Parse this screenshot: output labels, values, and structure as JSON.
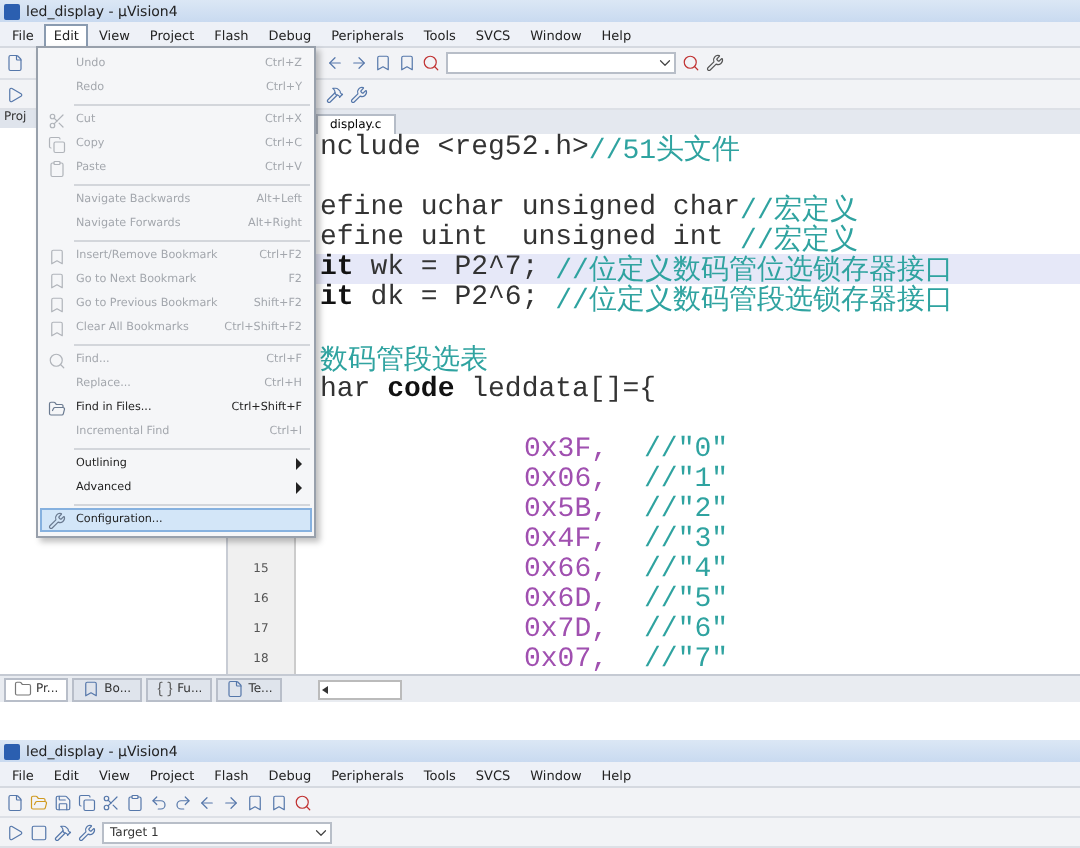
{
  "window": {
    "title": "led_display - µVision4"
  },
  "menu_bar": [
    {
      "label": "File",
      "selected": false
    },
    {
      "label": "Edit",
      "selected": true
    },
    {
      "label": "View",
      "selected": false
    },
    {
      "label": "Project",
      "selected": false
    },
    {
      "label": "Flash",
      "selected": false
    },
    {
      "label": "Debug",
      "selected": false
    },
    {
      "label": "Peripherals",
      "selected": false
    },
    {
      "label": "Tools",
      "selected": false
    },
    {
      "label": "SVCS",
      "selected": false
    },
    {
      "label": "Window",
      "selected": false
    },
    {
      "label": "Help",
      "selected": false
    }
  ],
  "project_panel": {
    "title": "Proj"
  },
  "editor": {
    "tab": "display.c",
    "lines": [
      {
        "kind": "code",
        "highlighted": false,
        "parts": [
          {
            "kind": "plain",
            "text": "nclude <reg52.h>"
          },
          {
            "kind": "comment",
            "text": "//51头文件"
          }
        ]
      },
      {
        "kind": "blank"
      },
      {
        "kind": "code",
        "highlighted": false,
        "parts": [
          {
            "kind": "plain",
            "text": "efine uchar unsigned char"
          },
          {
            "kind": "comment",
            "text": "//宏定义"
          }
        ]
      },
      {
        "kind": "code",
        "highlighted": false,
        "parts": [
          {
            "kind": "plain",
            "text": "efine uint  unsigned int "
          },
          {
            "kind": "comment",
            "text": "//宏定义"
          }
        ]
      },
      {
        "kind": "code",
        "highlighted": true,
        "parts": [
          {
            "kind": "keyword",
            "text": "it"
          },
          {
            "kind": "plain",
            "text": " wk = P2^7; "
          },
          {
            "kind": "comment",
            "text": "//位定义数码管位选锁存器接口"
          }
        ]
      },
      {
        "kind": "code",
        "highlighted": false,
        "parts": [
          {
            "kind": "keyword",
            "text": "it"
          },
          {
            "kind": "plain",
            "text": " dk = P2^6; "
          },
          {
            "kind": "comment",
            "text": "//位定义数码管段选锁存器接口"
          }
        ]
      },
      {
        "kind": "blank"
      },
      {
        "kind": "code",
        "highlighted": false,
        "parts": [
          {
            "kind": "comment",
            "text": "数码管段选表"
          }
        ]
      },
      {
        "kind": "code",
        "highlighted": false,
        "parts": [
          {
            "kind": "plain",
            "text": "har "
          },
          {
            "kind": "keyword",
            "text": "code"
          },
          {
            "kind": "plain",
            "text": " leddata[]={"
          }
        ]
      },
      {
        "kind": "blank"
      },
      {
        "kind": "entry",
        "highlighted": false,
        "parts": [
          {
            "kind": "number",
            "text": "0x3F,"
          },
          {
            "kind": "comment",
            "text": "//\"0\""
          }
        ]
      },
      {
        "kind": "entry",
        "highlighted": false,
        "parts": [
          {
            "kind": "number",
            "text": "0x06,"
          },
          {
            "kind": "comment",
            "text": "//\"1\""
          }
        ]
      },
      {
        "kind": "entry",
        "highlighted": false,
        "parts": [
          {
            "kind": "number",
            "text": "0x5B,"
          },
          {
            "kind": "comment",
            "text": "//\"2\""
          }
        ]
      },
      {
        "kind": "entry",
        "highlighted": false,
        "parts": [
          {
            "kind": "number",
            "text": "0x4F,"
          },
          {
            "kind": "comment",
            "text": "//\"3\""
          }
        ]
      },
      {
        "kind": "entry",
        "highlighted": false,
        "number": "15",
        "parts": [
          {
            "kind": "number",
            "text": "0x66,"
          },
          {
            "kind": "comment",
            "text": "//\"4\""
          }
        ]
      },
      {
        "kind": "entry",
        "highlighted": false,
        "number": "16",
        "parts": [
          {
            "kind": "number",
            "text": "0x6D,"
          },
          {
            "kind": "comment",
            "text": "//\"5\""
          }
        ]
      },
      {
        "kind": "entry",
        "highlighted": false,
        "number": "17",
        "parts": [
          {
            "kind": "number",
            "text": "0x7D,"
          },
          {
            "kind": "comment",
            "text": "//\"6\""
          }
        ]
      },
      {
        "kind": "entry",
        "highlighted": false,
        "number": "18",
        "parts": [
          {
            "kind": "number",
            "text": "0x07,"
          },
          {
            "kind": "comment",
            "text": "//\"7\""
          }
        ]
      }
    ]
  },
  "panel_tabs": [
    {
      "label": "Pr...",
      "selected": true
    },
    {
      "label": "Bo...",
      "selected": false
    },
    {
      "label": "Fu...",
      "selected": false
    },
    {
      "label": "Te...",
      "selected": false
    }
  ],
  "edit_menu": {
    "items": [
      {
        "kind": "item",
        "label": "Undo",
        "shortcut": "Ctrl+Z",
        "disabled": true,
        "selected": false
      },
      {
        "kind": "item",
        "label": "Redo",
        "shortcut": "Ctrl+Y",
        "disabled": true,
        "selected": false
      },
      {
        "kind": "separator"
      },
      {
        "kind": "item",
        "label": "Cut",
        "shortcut": "Ctrl+X",
        "disabled": true,
        "selected": false
      },
      {
        "kind": "item",
        "label": "Copy",
        "shortcut": "Ctrl+C",
        "disabled": true,
        "selected": false
      },
      {
        "kind": "item",
        "label": "Paste",
        "shortcut": "Ctrl+V",
        "disabled": true,
        "selected": false
      },
      {
        "kind": "separator"
      },
      {
        "kind": "item",
        "label": "Navigate Backwards",
        "shortcut": "Alt+Left",
        "disabled": true,
        "selected": false
      },
      {
        "kind": "item",
        "label": "Navigate Forwards",
        "shortcut": "Alt+Right",
        "disabled": true,
        "selected": false
      },
      {
        "kind": "separator"
      },
      {
        "kind": "item",
        "label": "Insert/Remove Bookmark",
        "shortcut": "Ctrl+F2",
        "disabled": true,
        "selected": false
      },
      {
        "kind": "item",
        "label": "Go to Next Bookmark",
        "shortcut": "F2",
        "disabled": true,
        "selected": false
      },
      {
        "kind": "item",
        "label": "Go to Previous Bookmark",
        "shortcut": "Shift+F2",
        "disabled": true,
        "selected": false
      },
      {
        "kind": "item",
        "label": "Clear All Bookmarks",
        "shortcut": "Ctrl+Shift+F2",
        "disabled": true,
        "selected": false
      },
      {
        "kind": "separator"
      },
      {
        "kind": "item",
        "label": "Find...",
        "shortcut": "Ctrl+F",
        "disabled": true,
        "selected": false
      },
      {
        "kind": "item",
        "label": "Replace...",
        "shortcut": "Ctrl+H",
        "disabled": true,
        "selected": false
      },
      {
        "kind": "item",
        "label": "Find in Files...",
        "shortcut": "Ctrl+Shift+F",
        "disabled": false,
        "selected": false
      },
      {
        "kind": "item",
        "label": "Incremental Find",
        "shortcut": "Ctrl+I",
        "disabled": true,
        "selected": false
      },
      {
        "kind": "separator"
      },
      {
        "kind": "submenu",
        "label": "Outlining",
        "disabled": false,
        "selected": false
      },
      {
        "kind": "submenu",
        "label": "Advanced",
        "disabled": false,
        "selected": false
      },
      {
        "kind": "separator"
      },
      {
        "kind": "item",
        "label": "Configuration...",
        "disabled": false,
        "selected": true
      }
    ]
  },
  "second_window": {
    "title": "led_display - µVision4",
    "menu_bar": [
      "File",
      "Edit",
      "View",
      "Project",
      "Flash",
      "Debug",
      "Peripherals",
      "Tools",
      "SVCS",
      "Window",
      "Help"
    ],
    "target": "Target 1"
  }
}
